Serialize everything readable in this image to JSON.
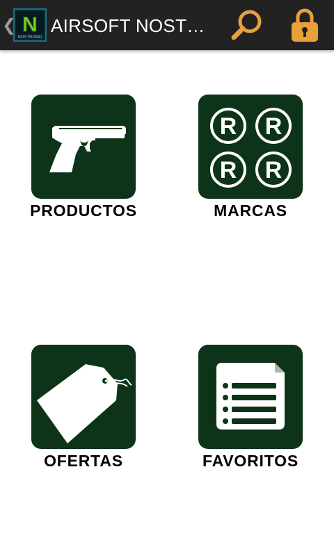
{
  "action_bar": {
    "title": "AIRSOFT NOSTROMO",
    "logo_letter": "N",
    "logo_text": "NOSTROMO",
    "back_icon": "chevron-left-icon",
    "search_icon": "search-icon",
    "lock_icon": "lock-icon",
    "accent_color": "#e8a13a",
    "background_color": "#222222"
  },
  "menu": {
    "tile_color": "#0d3319",
    "items": [
      {
        "label": "PRODUCTOS",
        "icon": "pistol-icon"
      },
      {
        "label": "MARCAS",
        "icon": "registered-marks-icon"
      },
      {
        "label": "OFERTAS",
        "icon": "price-tag-icon"
      },
      {
        "label": "FAVORITOS",
        "icon": "list-document-icon"
      }
    ]
  }
}
